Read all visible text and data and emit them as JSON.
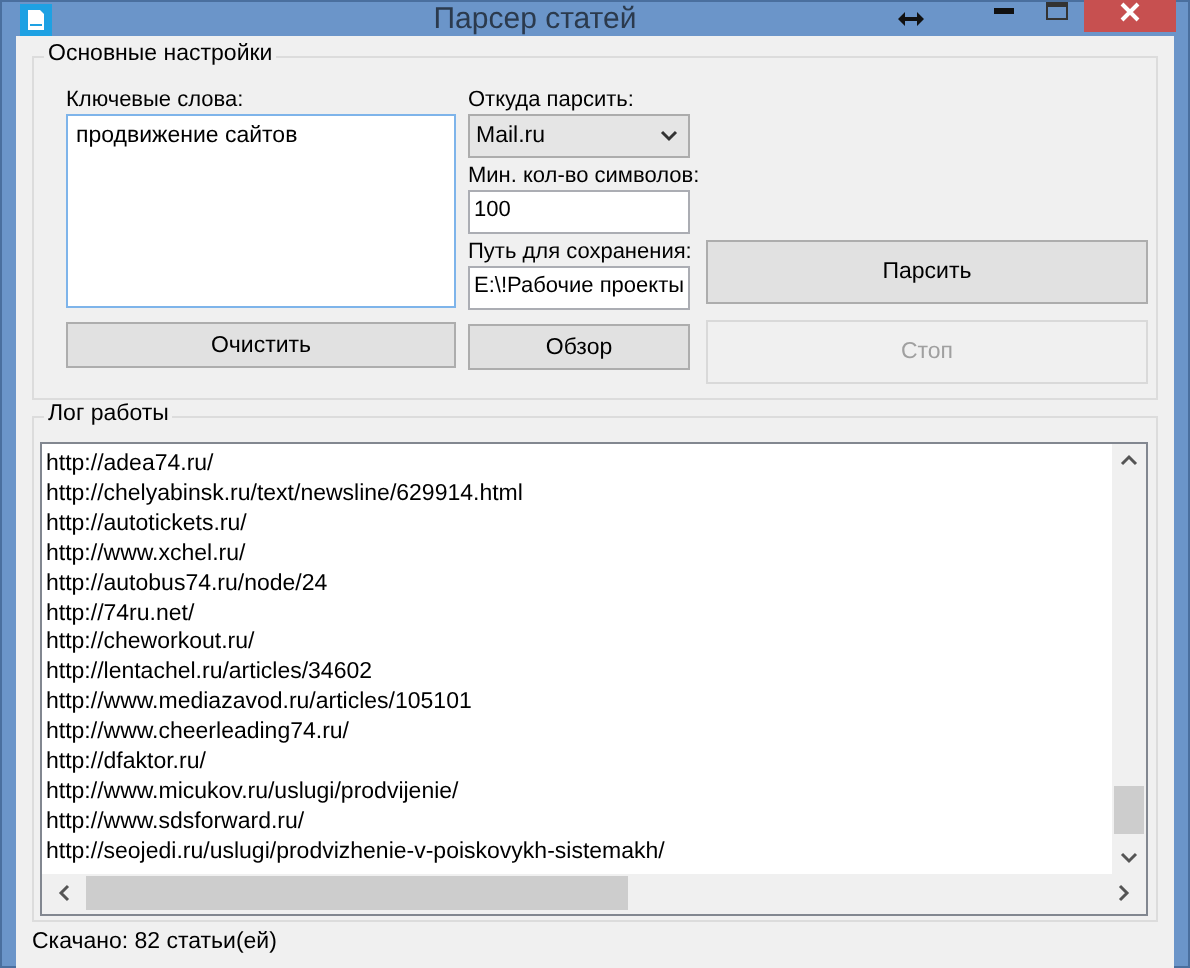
{
  "window": {
    "title": "Парсер статей"
  },
  "settings": {
    "legend": "Основные настройки",
    "keywords": {
      "label": "Ключевые слова:",
      "value": "продвижение сайтов"
    },
    "source": {
      "label": "Откуда парсить:",
      "value": "Mail.ru"
    },
    "min_chars": {
      "label": "Мин. кол-во символов:",
      "value": "100"
    },
    "save_path": {
      "label": "Путь для сохранения:",
      "value": "E:\\!Рабочие проекты"
    },
    "buttons": [
      {
        "label": "Очистить",
        "disabled": false
      },
      {
        "label": "Обзор",
        "disabled": false
      },
      {
        "label": "Парсить",
        "disabled": false
      },
      {
        "label": "Стоп",
        "disabled": true
      }
    ]
  },
  "log": {
    "legend": "Лог работы",
    "lines": [
      "http://adea74.ru/",
      "http://chelyabinsk.ru/text/newsline/629914.html",
      "http://autotickets.ru/",
      "http://www.xchel.ru/",
      "http://autobus74.ru/node/24",
      "http://74ru.net/",
      "http://cheworkout.ru/",
      "http://lentachel.ru/articles/34602",
      "http://www.mediazavod.ru/articles/105101",
      "http://www.cheerleading74.ru/",
      "http://dfaktor.ru/",
      "http://www.micukov.ru/uslugi/prodvijenie/",
      "http://www.sdsforward.ru/",
      "http://seojedi.ru/uslugi/prodvizhenie-v-poiskovykh-sistemakh/"
    ]
  },
  "status_bar": "Скачано: 82 статьи(ей)"
}
